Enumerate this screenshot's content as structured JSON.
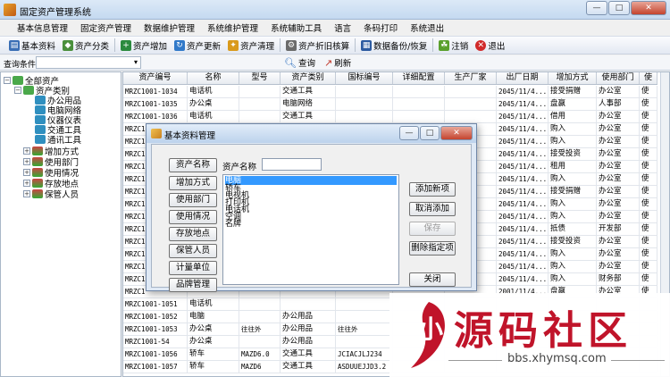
{
  "window": {
    "title": "固定资产管理系统",
    "buttons": [
      "—",
      "□",
      "✕"
    ]
  },
  "menu": [
    "基本信息管理",
    "固定资产管理",
    "数据维护管理",
    "系统维护管理",
    "系统辅助工具",
    "语言",
    "条码打印",
    "系统退出"
  ],
  "toolbar": [
    {
      "label": "基本资料",
      "icon": "book-icon",
      "color": "#3a6fb5"
    },
    {
      "label": "资产分类",
      "icon": "category-icon",
      "color": "#4a8f3c"
    },
    {
      "label": "资产增加",
      "icon": "add-asset-icon",
      "color": "#2b8a3e"
    },
    {
      "label": "资产更新",
      "icon": "refresh-asset-icon",
      "color": "#3179c9"
    },
    {
      "label": "资产清理",
      "icon": "cleanup-icon",
      "color": "#d99a1c"
    },
    {
      "label": "资产折旧核算",
      "icon": "depreciation-icon",
      "color": "#6b6b6b"
    },
    {
      "label": "数据备份/恢复",
      "icon": "backup-icon",
      "color": "#2c5aa0"
    },
    {
      "label": "注销",
      "icon": "logout-icon",
      "color": "#5aa02c"
    },
    {
      "label": "退出",
      "icon": "exit-icon",
      "color": "#d12a2a"
    }
  ],
  "query": {
    "label": "查询条件：",
    "select_value": "▾",
    "query_button": "查询",
    "refresh_button": "刷新"
  },
  "tree": [
    {
      "label": "全部资产",
      "level": 0,
      "box": "−"
    },
    {
      "label": "资产类别",
      "level": 1,
      "box": "−"
    },
    {
      "label": "办公用品",
      "level": 2,
      "box": ""
    },
    {
      "label": "电脑网络",
      "level": 2,
      "box": ""
    },
    {
      "label": "仪器仪表",
      "level": 2,
      "box": ""
    },
    {
      "label": "交通工具",
      "level": 2,
      "box": ""
    },
    {
      "label": "通讯工具",
      "level": 2,
      "box": ""
    },
    {
      "label": "增加方式",
      "level": 1,
      "box": "+"
    },
    {
      "label": "使用部门",
      "level": 1,
      "box": "+"
    },
    {
      "label": "使用情况",
      "level": 1,
      "box": "+"
    },
    {
      "label": "存放地点",
      "level": 1,
      "box": "+"
    },
    {
      "label": "保管人员",
      "level": 1,
      "box": "+"
    }
  ],
  "grid": {
    "columns": [
      "资产编号",
      "名称",
      "型号",
      "资产类别",
      "国标编号",
      "详细配置",
      "生产厂家",
      "出厂日期",
      "增加方式",
      "使用部门",
      "使"
    ],
    "rows": [
      [
        "MRZC1001-1034",
        "电话机",
        "",
        "交通工具",
        "",
        "",
        "",
        "2045/11/4...",
        "接受捐赠",
        "办公室",
        "使"
      ],
      [
        "MRZC1001-1035",
        "办公桌",
        "",
        "电脑网络",
        "",
        "",
        "",
        "2045/11/4...",
        "盘赢",
        "人事部",
        "使"
      ],
      [
        "MRZC1001-1036",
        "电话机",
        "",
        "交通工具",
        "",
        "",
        "",
        "2045/11/4...",
        "借用",
        "办公室",
        "使"
      ],
      [
        "MRZC1",
        "",
        "",
        "",
        "",
        "",
        "",
        "2045/11/4...",
        "购入",
        "办公室",
        "使"
      ],
      [
        "MRZC1",
        "",
        "",
        "",
        "",
        "",
        "",
        "2045/11/4...",
        "购入",
        "办公室",
        "使"
      ],
      [
        "MRZC1",
        "",
        "",
        "",
        "",
        "",
        "",
        "2045/11/4...",
        "接受投资",
        "办公室",
        "使"
      ],
      [
        "MRZC1",
        "",
        "",
        "",
        "",
        "",
        "",
        "2045/11/4...",
        "租用",
        "办公室",
        "使"
      ],
      [
        "MRZC1",
        "",
        "",
        "",
        "",
        "",
        "",
        "2045/11/4...",
        "购入",
        "办公室",
        "使"
      ],
      [
        "MRZC1",
        "",
        "",
        "",
        "",
        "",
        "",
        "2045/11/4...",
        "接受捐赠",
        "办公室",
        "使"
      ],
      [
        "MRZC1",
        "",
        "",
        "",
        "",
        "",
        "",
        "2045/11/4...",
        "购入",
        "办公室",
        "使"
      ],
      [
        "MRZC1",
        "",
        "",
        "",
        "",
        "",
        "",
        "2045/11/4...",
        "购入",
        "办公室",
        "使"
      ],
      [
        "MRZC1",
        "",
        "",
        "",
        "",
        "",
        "",
        "2045/11/4...",
        "抵债",
        "开发部",
        "使"
      ],
      [
        "MRZC1",
        "",
        "",
        "",
        "",
        "",
        "",
        "2045/11/4...",
        "接受投资",
        "办公室",
        "使"
      ],
      [
        "MRZC1",
        "",
        "",
        "",
        "",
        "",
        "",
        "2045/11/4...",
        "购入",
        "办公室",
        "使"
      ],
      [
        "MRZC1",
        "",
        "",
        "",
        "",
        "",
        "",
        "2045/11/4...",
        "购入",
        "办公室",
        "使"
      ],
      [
        "MRZC1",
        "",
        "",
        "",
        "",
        "",
        "",
        "2045/11/4...",
        "购入",
        "财务部",
        "使"
      ],
      [
        "MRZC1",
        "",
        "",
        "",
        "",
        "",
        "",
        "2001/11/4...",
        "盘赢",
        "办公室",
        "使"
      ],
      [
        "MRZC1001-1051",
        "电话机",
        "",
        "",
        "",
        "",
        "",
        "",
        "",
        "",
        ""
      ],
      [
        "MRZC1001-1052",
        "电脑",
        "",
        "办公用品",
        "",
        "",
        "",
        "",
        "",
        "",
        ""
      ],
      [
        "MRZC1001-1053",
        "办公桌",
        "往往外",
        "办公用品",
        "往往外",
        "",
        "",
        "",
        "",
        "",
        ""
      ],
      [
        "MRZC1001-54",
        "办公桌",
        "",
        "办公用品",
        "",
        "",
        "",
        "",
        "",
        "",
        ""
      ],
      [
        "MRZC1001-1056",
        "轿车",
        "MAZD6.0",
        "交通工具",
        "JCIACJLJ234",
        "",
        "",
        "",
        "",
        "",
        ""
      ],
      [
        "MRZC1001-1057",
        "轿车",
        "MAZD6",
        "交通工具",
        "ASDUUEJJD3.2",
        "",
        "",
        "",
        "",
        "",
        ""
      ]
    ]
  },
  "dialog": {
    "title": "基本资料管理",
    "left_buttons": [
      "资产名称",
      "增加方式",
      "使用部门",
      "使用情况",
      "存放地点",
      "保管人员",
      "计量单位",
      "品牌管理"
    ],
    "field_label": "资产名称",
    "field_value": "",
    "list_items": [
      "电脑",
      "轿车",
      "电视机",
      "打印机",
      "电话机",
      "空调",
      "名牌"
    ],
    "right_buttons": {
      "add_new": "添加新项",
      "cancel_add": "取消添加",
      "save": "保存",
      "delete": "删除指定项",
      "close": "关闭"
    }
  },
  "watermark": {
    "title": "源码社区",
    "url": "bbs.xhymsq.com",
    "logo_text": "小"
  }
}
